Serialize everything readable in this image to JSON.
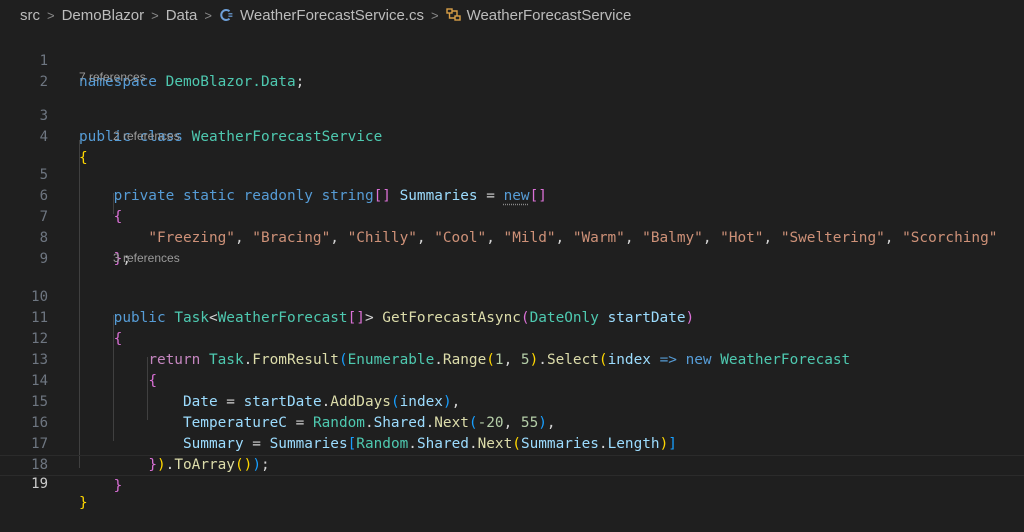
{
  "breadcrumb": {
    "items": [
      "src",
      "DemoBlazor",
      "Data",
      "WeatherForecastService.cs",
      "WeatherForecastService"
    ],
    "separator": ">"
  },
  "code_lens": {
    "class_refs": "7 references",
    "field_refs": "2 references",
    "method_refs": "3 references"
  },
  "line_numbers": [
    "1",
    "2",
    "3",
    "4",
    "5",
    "6",
    "7",
    "8",
    "9",
    "10",
    "11",
    "12",
    "13",
    "14",
    "15",
    "16",
    "17",
    "18",
    "19"
  ],
  "code": {
    "l1": {
      "kw": "namespace",
      "ns": "DemoBlazor.Data",
      "semi": ";"
    },
    "l3": {
      "kw1": "public",
      "kw2": "class",
      "name": "WeatherForecastService"
    },
    "l4": {
      "brace": "{"
    },
    "l5": {
      "kw1": "private",
      "kw2": "static",
      "kw3": "readonly",
      "type": "string",
      "br": "[]",
      "name": "Summaries",
      "eq": "=",
      "kw4": "new",
      "br2": "[]"
    },
    "l6": {
      "brace": "{"
    },
    "l7": {
      "strings": [
        "\"Freezing\"",
        "\"Bracing\"",
        "\"Chilly\"",
        "\"Cool\"",
        "\"Mild\"",
        "\"Warm\"",
        "\"Balmy\"",
        "\"Hot\"",
        "\"Sweltering\"",
        "\"Scorching\""
      ]
    },
    "l8": {
      "brace": "}",
      "semi": ";"
    },
    "l10": {
      "kw": "public",
      "type1": "Task",
      "lt": "<",
      "type2": "WeatherForecast",
      "br": "[]",
      "gt": ">",
      "method": "GetForecastAsync",
      "op": "(",
      "ptype": "DateOnly",
      "pname": "startDate",
      "cp": ")"
    },
    "l11": {
      "brace": "{"
    },
    "l12": {
      "kw": "return",
      "t1": "Task",
      "m1": "FromResult",
      "t2": "Enumerable",
      "m2": "Range",
      "n1": "1",
      "n2": "5",
      "m3": "Select",
      "v1": "index",
      "arrow": "=>",
      "kw2": "new",
      "t3": "WeatherForecast"
    },
    "l13": {
      "brace": "{"
    },
    "l14": {
      "prop": "Date",
      "v": "startDate",
      "m": "AddDays",
      "arg": "index"
    },
    "l15": {
      "prop": "TemperatureC",
      "t": "Random",
      "p": "Shared",
      "m": "Next",
      "n1": "-20",
      "n2": "55"
    },
    "l16": {
      "prop": "Summary",
      "v": "Summaries",
      "t": "Random",
      "p": "Shared",
      "m": "Next",
      "v2": "Summaries",
      "p2": "Length"
    },
    "l17": {
      "m": "ToArray"
    },
    "l18": {
      "brace": "}"
    },
    "l19": {
      "brace": "}"
    }
  },
  "colors": {
    "background": "#1f1f1f",
    "keyword": "#569cd6",
    "type": "#4ec9b0",
    "function": "#dcdcaa",
    "variable": "#9cdcfe",
    "string": "#ce9178",
    "number": "#b5cea8",
    "bracket_gold": "#ffd700",
    "bracket_orchid": "#da70d6",
    "bracket_blue": "#179fff"
  }
}
